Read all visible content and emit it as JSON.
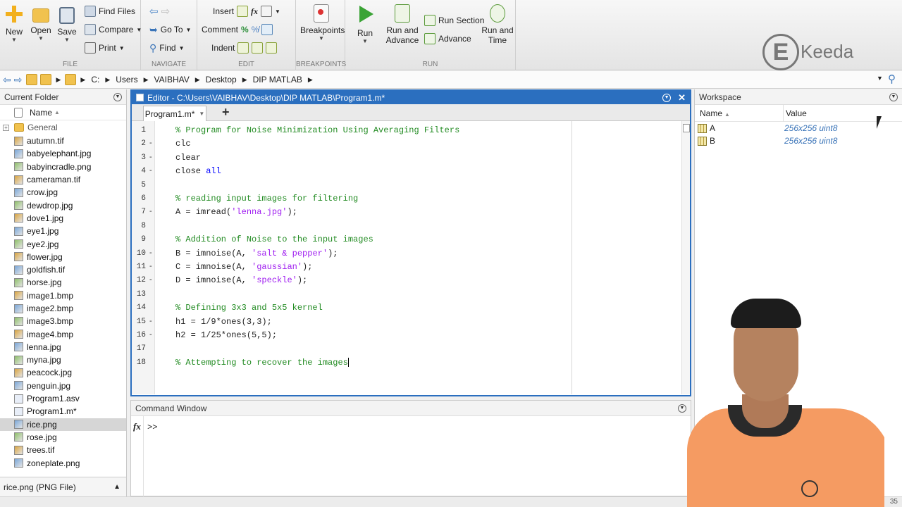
{
  "ribbon": {
    "file": {
      "new": "New",
      "open": "Open",
      "save": "Save",
      "find_files": "Find Files",
      "compare": "Compare",
      "print": "Print",
      "group": "FILE"
    },
    "navigate": {
      "goto": "Go To",
      "find": "Find",
      "group": "NAVIGATE"
    },
    "edit": {
      "insert": "Insert",
      "comment": "Comment",
      "indent": "Indent",
      "fx": "fx",
      "group": "EDIT"
    },
    "breakpoints": {
      "label": "Breakpoints",
      "group": "BREAKPOINTS"
    },
    "run": {
      "run": "Run",
      "run_advance_1": "Run and",
      "run_advance_2": "Advance",
      "run_section": "Run Section",
      "advance": "Advance",
      "run_time_1": "Run and",
      "run_time_2": "Time",
      "group": "RUN"
    }
  },
  "logo": {
    "letter": "E",
    "text": "Keeda"
  },
  "address": {
    "segments": [
      "C:",
      "Users",
      "VAIBHAV",
      "Desktop",
      "DIP MATLAB"
    ]
  },
  "current_folder": {
    "title": "Current Folder",
    "column": "Name",
    "folder": "General",
    "files": [
      "autumn.tif",
      "babyelephant.jpg",
      "babyincradle.png",
      "cameraman.tif",
      "crow.jpg",
      "dewdrop.jpg",
      "dove1.jpg",
      "eye1.jpg",
      "eye2.jpg",
      "flower.jpg",
      "goldfish.tif",
      "horse.jpg",
      "image1.bmp",
      "image2.bmp",
      "image3.bmp",
      "image4.bmp",
      "lenna.jpg",
      "myna.jpg",
      "peacock.jpg",
      "penguin.jpg",
      "Program1.asv",
      "Program1.m*",
      "rice.png",
      "rose.jpg",
      "trees.tif",
      "zoneplate.png"
    ],
    "selected": "rice.png",
    "details": "rice.png (PNG File)"
  },
  "editor": {
    "title": "Editor - C:\\Users\\VAIBHAV\\Desktop\\DIP MATLAB\\Program1.m*",
    "tab": "Program1.m*",
    "add_tab": "+",
    "lines": [
      {
        "n": "1",
        "d": "",
        "t": "% Program for Noise Minimization Using Averaging Filters",
        "k": "com"
      },
      {
        "n": "2",
        "d": "-",
        "t": "clc",
        "k": "plain"
      },
      {
        "n": "3",
        "d": "-",
        "t": "clear",
        "k": "plain"
      },
      {
        "n": "4",
        "d": "-",
        "t": "close ",
        "t2": "all",
        "k": "kw"
      },
      {
        "n": "5",
        "d": "",
        "t": "",
        "k": "plain"
      },
      {
        "n": "6",
        "d": "",
        "t": "% reading input images for filtering",
        "k": "com"
      },
      {
        "n": "7",
        "d": "-",
        "t": "A = imread(",
        "s": "'lenna.jpg'",
        "e": ");",
        "k": "str"
      },
      {
        "n": "8",
        "d": "",
        "t": "",
        "k": "plain"
      },
      {
        "n": "9",
        "d": "",
        "t": "% Addition of Noise to the input images",
        "k": "com"
      },
      {
        "n": "10",
        "d": "-",
        "t": "B = imnoise(A, ",
        "s": "'salt & pepper'",
        "e": ");",
        "k": "str"
      },
      {
        "n": "11",
        "d": "-",
        "t": "C = imnoise(A, ",
        "s": "'gaussian'",
        "e": ");",
        "k": "str"
      },
      {
        "n": "12",
        "d": "-",
        "t": "D = imnoise(A, ",
        "s": "'speckle'",
        "e": ");",
        "k": "str"
      },
      {
        "n": "13",
        "d": "",
        "t": "",
        "k": "plain"
      },
      {
        "n": "14",
        "d": "",
        "t": "% Defining 3x3 and 5x5 kernel",
        "k": "com"
      },
      {
        "n": "15",
        "d": "-",
        "t": "h1 = 1/9*ones(3,3);",
        "k": "plain"
      },
      {
        "n": "16",
        "d": "-",
        "t": "h2 = 1/25*ones(5,5);",
        "k": "plain"
      },
      {
        "n": "17",
        "d": "",
        "t": "",
        "k": "plain"
      },
      {
        "n": "18",
        "d": "",
        "t": "% Attempting to recover the images",
        "k": "com"
      }
    ]
  },
  "command_window": {
    "title": "Command Window",
    "fx": "fx",
    "prompt": ">>"
  },
  "workspace": {
    "title": "Workspace",
    "col_name": "Name",
    "col_value": "Value",
    "vars": [
      {
        "name": "A",
        "value": "256x256 uint8"
      },
      {
        "name": "B",
        "value": "256x256 uint8"
      }
    ]
  },
  "status": {
    "right": "35"
  },
  "colors": {
    "accent": "#2b6fbf",
    "comment": "#228b22",
    "string": "#a020f0",
    "keyword": "#0000ff",
    "shirt": "#f59b62"
  }
}
